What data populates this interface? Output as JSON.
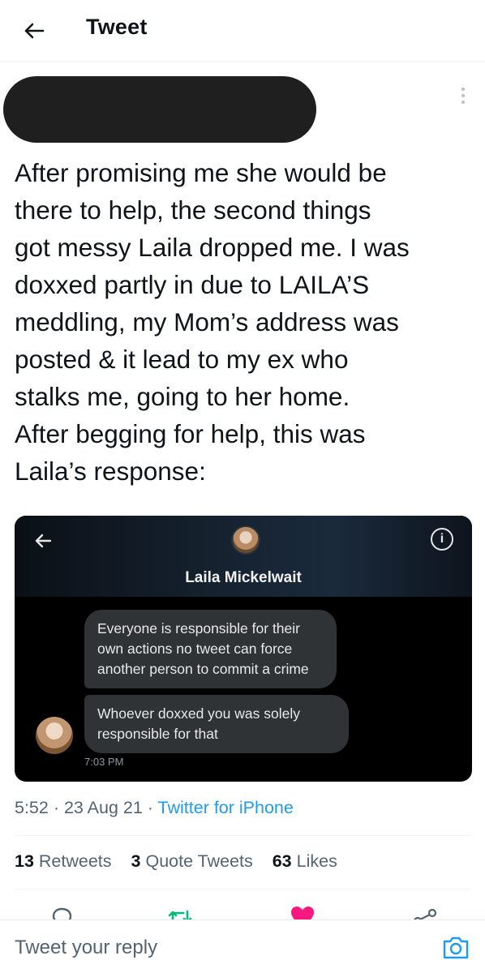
{
  "header": {
    "title": "Tweet"
  },
  "tweet": {
    "text": "After promising me she would be\nthere to help, the second things\ngot messy Laila dropped me. I was\ndoxxed partly in due to LAILA’S\nmeddling, my Mom’s address was\nposted & it lead to my ex who\nstalks me, going to her home.\nAfter begging for help, this was\nLaila’s response:",
    "time": "5:52",
    "date": "23 Aug 21",
    "source": "Twitter for iPhone"
  },
  "embedded_screenshot": {
    "contact_name": "Laila Mickelwait",
    "messages": [
      "Everyone is responsible for their own actions no tweet can force another person to commit a crime",
      "Whoever doxxed you was solely responsible for that"
    ],
    "timestamp": "7:03 PM"
  },
  "stats": {
    "retweets_count": "13",
    "retweets_label": "Retweets",
    "quotes_count": "3",
    "quotes_label": "Quote Tweets",
    "likes_count": "63",
    "likes_label": "Likes"
  },
  "reply": {
    "placeholder": "Tweet your reply"
  },
  "colors": {
    "accent": "#1d9bf0",
    "like": "#f91880",
    "retweet": "#00ba7c"
  },
  "icons": [
    "back-arrow-icon",
    "more-icon",
    "reply-icon",
    "retweet-icon",
    "like-icon",
    "share-icon",
    "camera-icon",
    "info-icon"
  ]
}
